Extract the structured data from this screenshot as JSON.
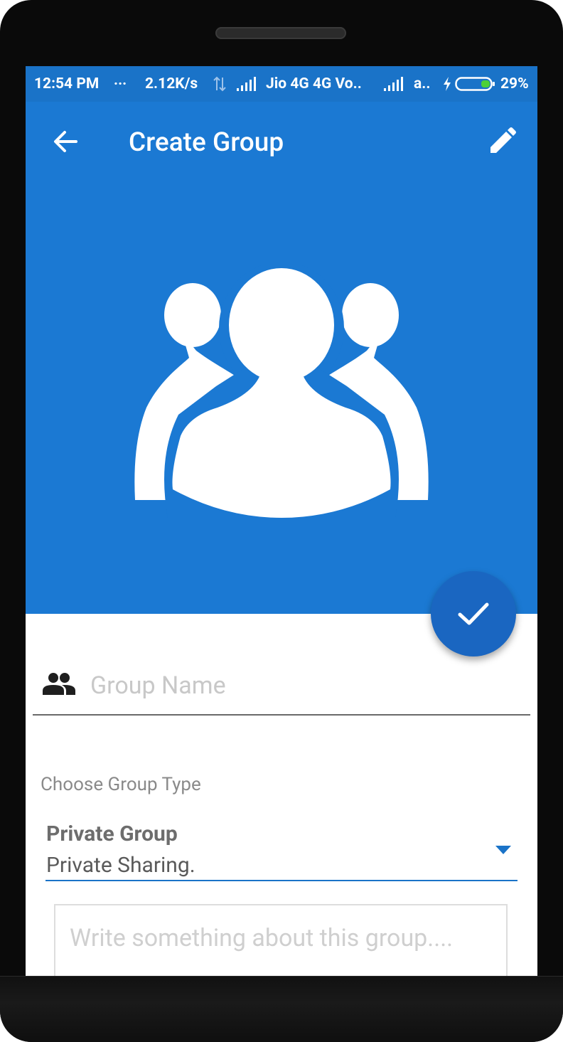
{
  "status_bar": {
    "time": "12:54 PM",
    "dots": "...",
    "speed": "2.12K/s",
    "carrier": "Jio 4G 4G Vo..",
    "extra": "a..",
    "battery": "29%"
  },
  "appbar": {
    "title": "Create Group"
  },
  "form": {
    "group_name_placeholder": "Group Name",
    "choose_type_label": "Choose Group Type",
    "selected_type": "Private Group",
    "selected_type_desc": "Private Sharing.",
    "about_placeholder": "Write something about this group...."
  },
  "colors": {
    "primary": "#1b79d3",
    "status_bar": "#1a73c8",
    "fab": "#1a66c1",
    "battery_fill": "#4cd137"
  },
  "icons": {
    "back": "arrow-left-icon",
    "edit": "pencil-icon",
    "group_avatar": "group-people-icon",
    "confirm": "check-icon",
    "group_field": "people-icon",
    "dropdown": "triangle-down-icon"
  }
}
